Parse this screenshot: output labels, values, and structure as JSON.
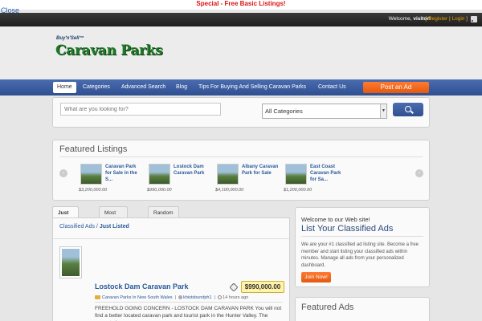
{
  "promo": {
    "text": "Special - Free Basic Listings!"
  },
  "close": {
    "label": "Close"
  },
  "topbar": {
    "welcome_prefix": "Welcome,",
    "visitor": "visitor!",
    "register": "Register",
    "login": "Login"
  },
  "logo": {
    "small": "Buy'n'Sell™",
    "main": "Caravan Parks"
  },
  "nav": {
    "items": [
      "Home",
      "Categories",
      "Advanced Search",
      "Blog",
      "Tips For Buying And Selling Caravan Parks",
      "Contact Us"
    ],
    "post_button": "Post an Ad"
  },
  "search": {
    "placeholder": "What are you looking for?",
    "category": "All Categories"
  },
  "featured": {
    "title": "Featured Listings",
    "items": [
      {
        "name": "Caravan Park for Sale in the S...",
        "price": "$3,200,000.00"
      },
      {
        "name": "Lostock Dam Caravan Park",
        "price": "$990,000.00"
      },
      {
        "name": "Albany Caravan Park for Sale",
        "price": "$4,100,000.00"
      },
      {
        "name": "East Coast Caravan Park for Sa...",
        "price": "$1,200,000.00"
      }
    ]
  },
  "tabs": [
    "Just Listed",
    "Most Popular",
    "Random"
  ],
  "breadcrumb": {
    "root": "Classified Ads",
    "sep": "/",
    "current": "Just Listed"
  },
  "listing": {
    "title": "Lostock Dam Caravan Park",
    "price": "$990,000.00",
    "category": "Caravan Parks In New South Wales",
    "author": "khistsbundph1",
    "time": "14 hours ago",
    "description": "FREEHOLD GOING CONCERN - LOSTOCK DAM CARAVAN PARK You will not find a better located caravan park and tourist park in the Hunter Valley. The property is"
  },
  "sidebar": {
    "welcome": "Welcome to our Web site!",
    "headline": "List Your Classified Ads",
    "text": "We are your #1 classified ad listing site. Become a free member and start listing your classified ads within minutes. Manage all ads from your personalized dashboard.",
    "join": "Join Now!",
    "featured_ads": "Featured Ads"
  }
}
